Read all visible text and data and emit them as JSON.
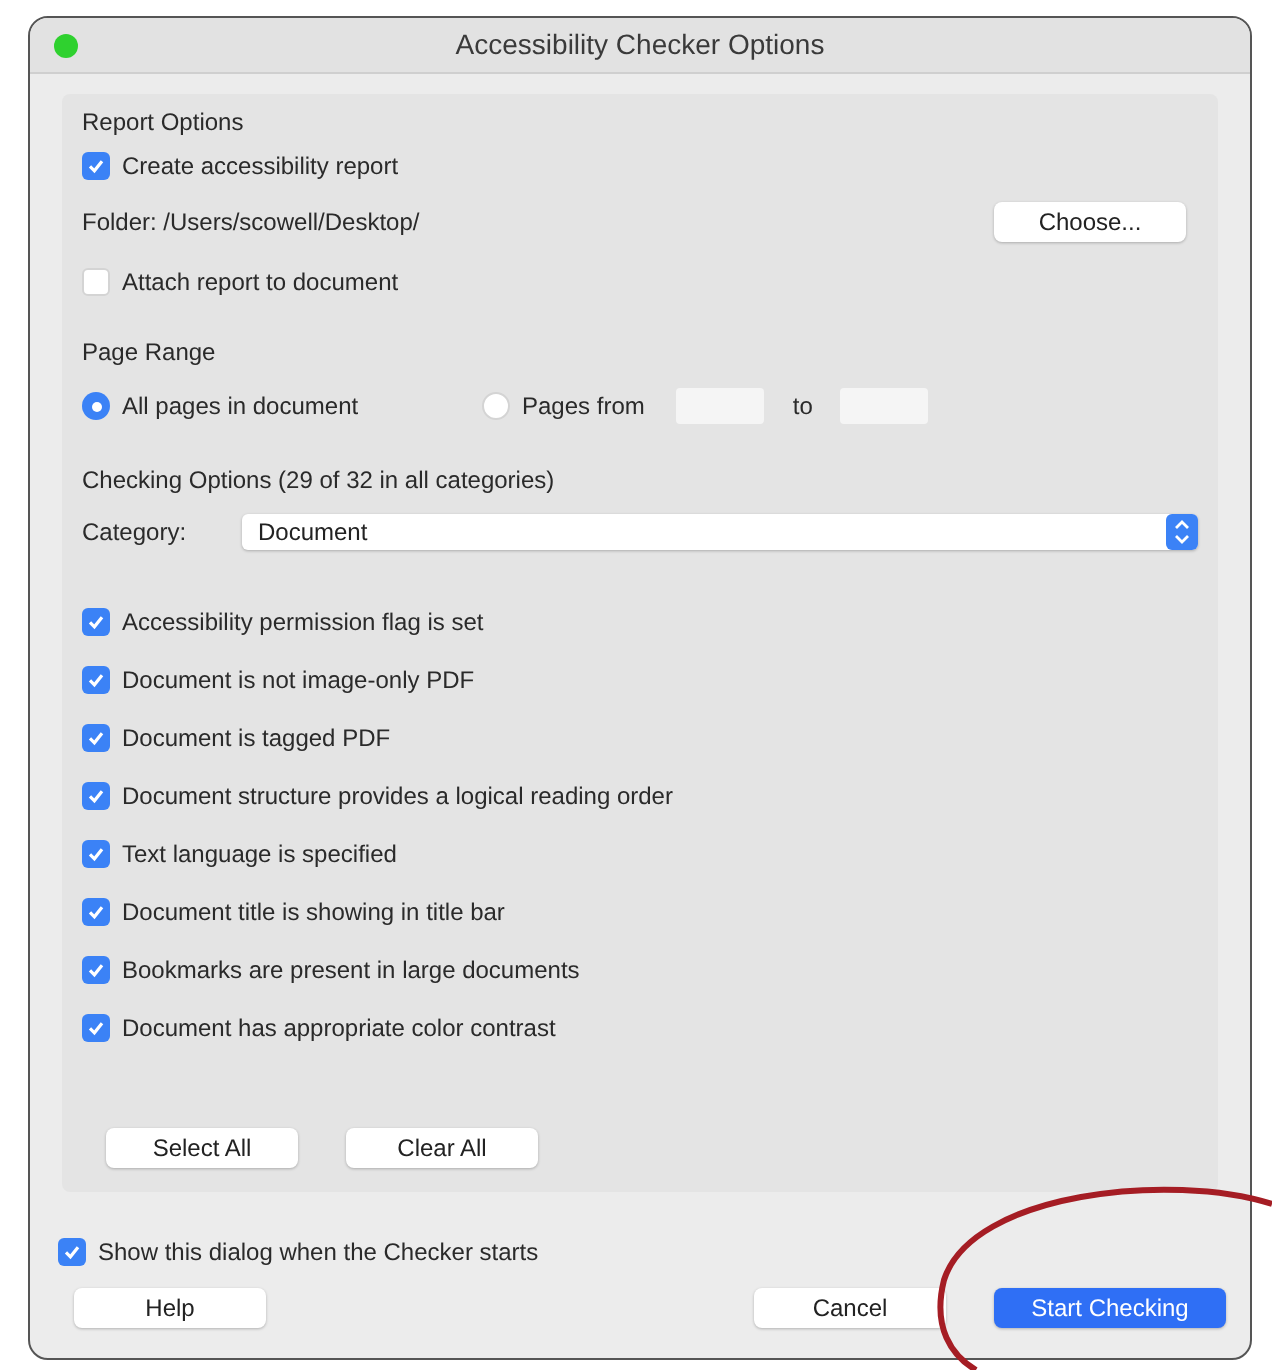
{
  "window": {
    "title": "Accessibility Checker Options"
  },
  "report_options": {
    "heading": "Report Options",
    "create_report": {
      "label": "Create accessibility report",
      "checked": true
    },
    "folder": "Folder: /Users/scowell/Desktop/",
    "choose_button": "Choose...",
    "attach_report": {
      "label": "Attach report to document",
      "checked": false
    }
  },
  "page_range": {
    "heading": "Page Range",
    "options": [
      {
        "label": "All pages in document",
        "selected": true
      },
      {
        "label": "Pages from",
        "selected": false
      }
    ],
    "to_label": "to"
  },
  "checking_options": {
    "heading": "Checking Options (29 of 32 in all categories)",
    "category_label": "Category:",
    "category_value": "Document",
    "items": [
      {
        "label": "Accessibility permission flag is set",
        "checked": true
      },
      {
        "label": "Document is not image-only PDF",
        "checked": true
      },
      {
        "label": "Document is tagged PDF",
        "checked": true
      },
      {
        "label": "Document structure provides a logical reading order",
        "checked": true
      },
      {
        "label": "Text language is specified",
        "checked": true
      },
      {
        "label": "Document title is showing in title bar",
        "checked": true
      },
      {
        "label": "Bookmarks are present in large documents",
        "checked": true
      },
      {
        "label": "Document has appropriate color contrast",
        "checked": true
      }
    ],
    "buttons": [
      "Select All",
      "Clear All"
    ]
  },
  "show_dialog": {
    "label": "Show this dialog when the Checker starts",
    "checked": true
  },
  "footer_buttons": [
    {
      "label": "Help",
      "kind": "plain"
    },
    {
      "label": "Cancel",
      "kind": "plain"
    },
    {
      "label": "Start Checking",
      "kind": "primary"
    }
  ]
}
